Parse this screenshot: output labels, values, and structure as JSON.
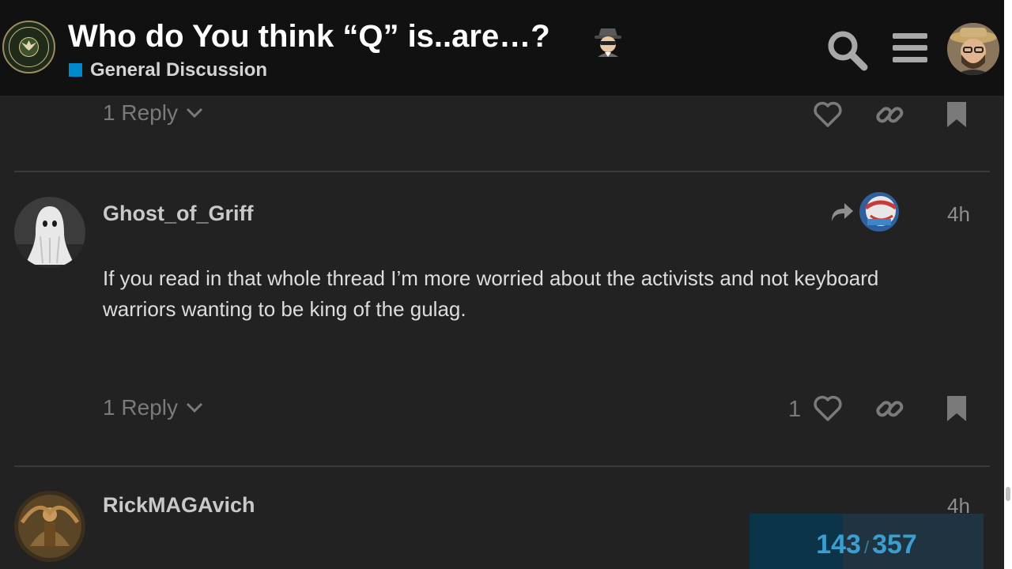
{
  "header": {
    "topic_title": "Who do You think “Q” is..are…?",
    "category": "General Discussion",
    "colors": {
      "category": "#0088cc",
      "background": "#111111"
    },
    "icons": [
      "army-seal-logo-icon",
      "spy-emoji-icon",
      "search-icon",
      "hamburger-menu-icon",
      "user-avatar"
    ]
  },
  "previous_post": {
    "replies_label": "1 Reply"
  },
  "posts": [
    {
      "username": "Ghost_of_Griff",
      "time": "4h",
      "body": "If you read in that whole thread I’m more worried about the activists and not keyboard warriors wanting to be king of the gulag.",
      "replies_label": "1 Reply",
      "likes": "1"
    },
    {
      "username": "RickMAGAvich",
      "time": "4h"
    }
  ],
  "progress": {
    "current": "143",
    "separator": "/",
    "total": "357",
    "fraction": 0.4
  }
}
